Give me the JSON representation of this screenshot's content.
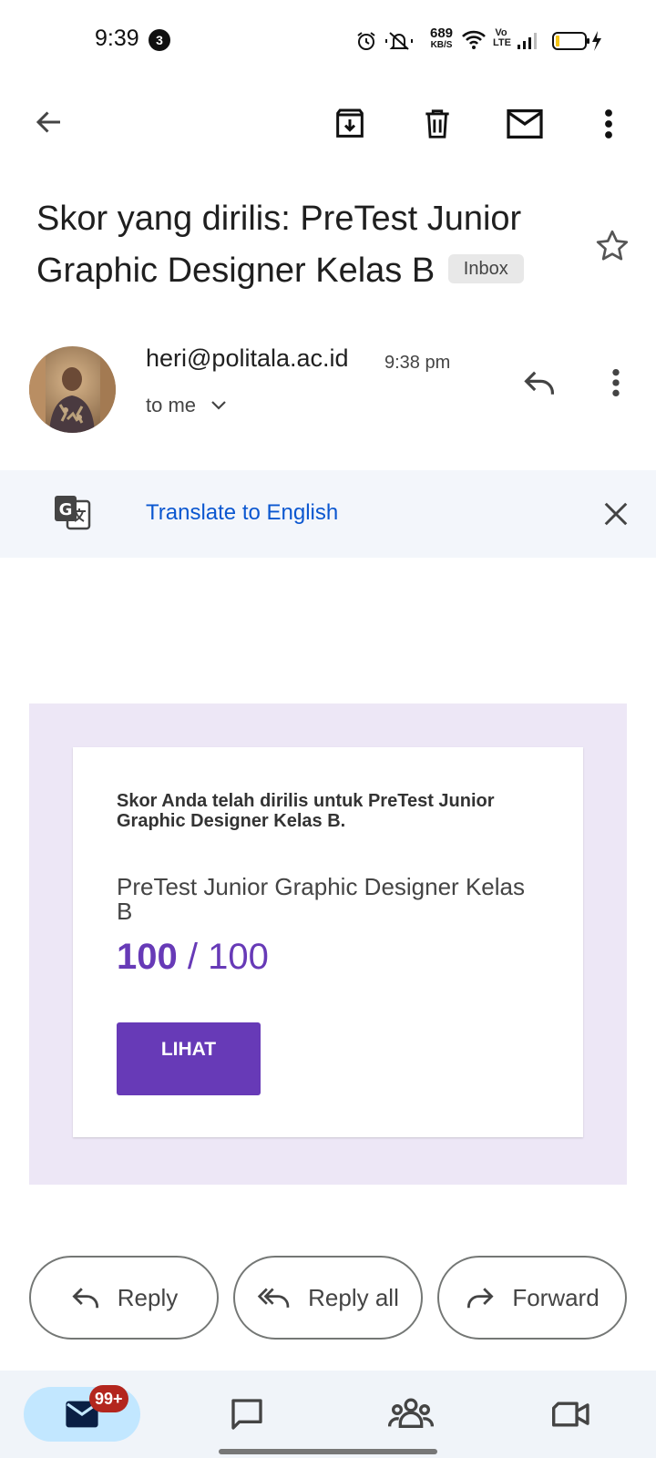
{
  "status_bar": {
    "time": "9:39",
    "notification_count": "3",
    "net_speed": "689",
    "net_speed_unit": "KB/S",
    "volte": "Vo LTE"
  },
  "toolbar": {
    "back_icon": "arrow-left-icon",
    "archive_icon": "archive-icon",
    "delete_icon": "trash-icon",
    "mark_unread_icon": "mail-icon",
    "more_icon": "more-vert-icon"
  },
  "email": {
    "subject": "Skor yang dirilis: PreTest Junior Graphic Designer Kelas B",
    "label": "Inbox",
    "sender": "heri@politala.ac.id",
    "time": "9:38 pm",
    "recipient": "to me"
  },
  "translate": {
    "link": "Translate to English"
  },
  "card": {
    "message": "Skor Anda telah dirilis untuk PreTest Junior Graphic Designer Kelas B.",
    "test_name": "PreTest Junior Graphic Designer Kelas B",
    "score": "100",
    "score_sep": " / ",
    "max_score": "100",
    "button": "LIHAT"
  },
  "actions": {
    "reply": "Reply",
    "reply_all": "Reply all",
    "forward": "Forward"
  },
  "bottom_nav": {
    "mail_badge": "99+",
    "items": [
      "mail-icon",
      "chat-icon",
      "spaces-icon",
      "meet-icon"
    ]
  },
  "colors": {
    "accent": "#673ab7",
    "card_bg": "#ede7f6",
    "link": "#0b57d0",
    "nav_selected": "#c2e7ff",
    "badge": "#b3261e"
  }
}
